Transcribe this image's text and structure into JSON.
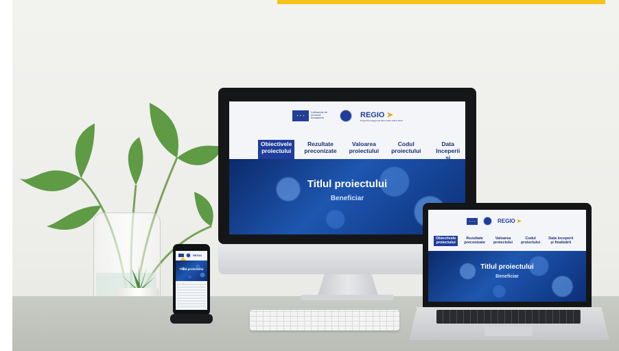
{
  "site": {
    "logos": {
      "eu_text": "Cofinanțat de Uniunea Europeană",
      "brand": "REGIO",
      "brand_tagline": "Programul Regional Nord-Vest 2021-2027"
    },
    "nav": [
      {
        "label": "Obiectivele\nproiectului",
        "active": true
      },
      {
        "label": "Rezultate\npreconizate",
        "active": false
      },
      {
        "label": "Valoarea\nproiectului",
        "active": false
      },
      {
        "label": "Codul\nproiectului",
        "active": false
      },
      {
        "label": "Data începerii\nși finalizării",
        "active": false
      }
    ],
    "hero": {
      "title": "Titlul proiectului",
      "subtitle": "Beneficiar"
    }
  },
  "colors": {
    "accent_bar": "#f5c31a",
    "primary_blue": "#1f3d9a",
    "hero_blue": "#1e56b0"
  }
}
